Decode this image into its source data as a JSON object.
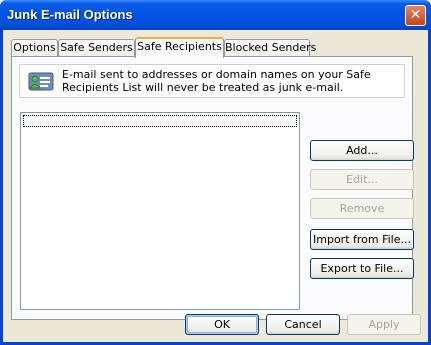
{
  "window": {
    "title": "Junk E-mail Options",
    "close_glyph": "✕"
  },
  "tabs": [
    {
      "label": "Options",
      "active": false
    },
    {
      "label": "Safe Senders",
      "active": false
    },
    {
      "label": "Safe Recipients",
      "active": true
    },
    {
      "label": "Blocked Senders",
      "active": false
    }
  ],
  "info": {
    "icon": "people-contacts-icon",
    "text": "E-mail sent to addresses or domain names on your Safe Recipients List will never be treated as junk e-mail."
  },
  "list": {
    "items": []
  },
  "side_buttons": [
    {
      "label": "Add...",
      "enabled": true
    },
    {
      "label": "Edit...",
      "enabled": false
    },
    {
      "label": "Remove",
      "enabled": false
    },
    {
      "label": "Import from File...",
      "enabled": true
    },
    {
      "label": "Export to File...",
      "enabled": true
    }
  ],
  "footer": {
    "ok": "OK",
    "cancel": "Cancel",
    "apply": "Apply"
  }
}
